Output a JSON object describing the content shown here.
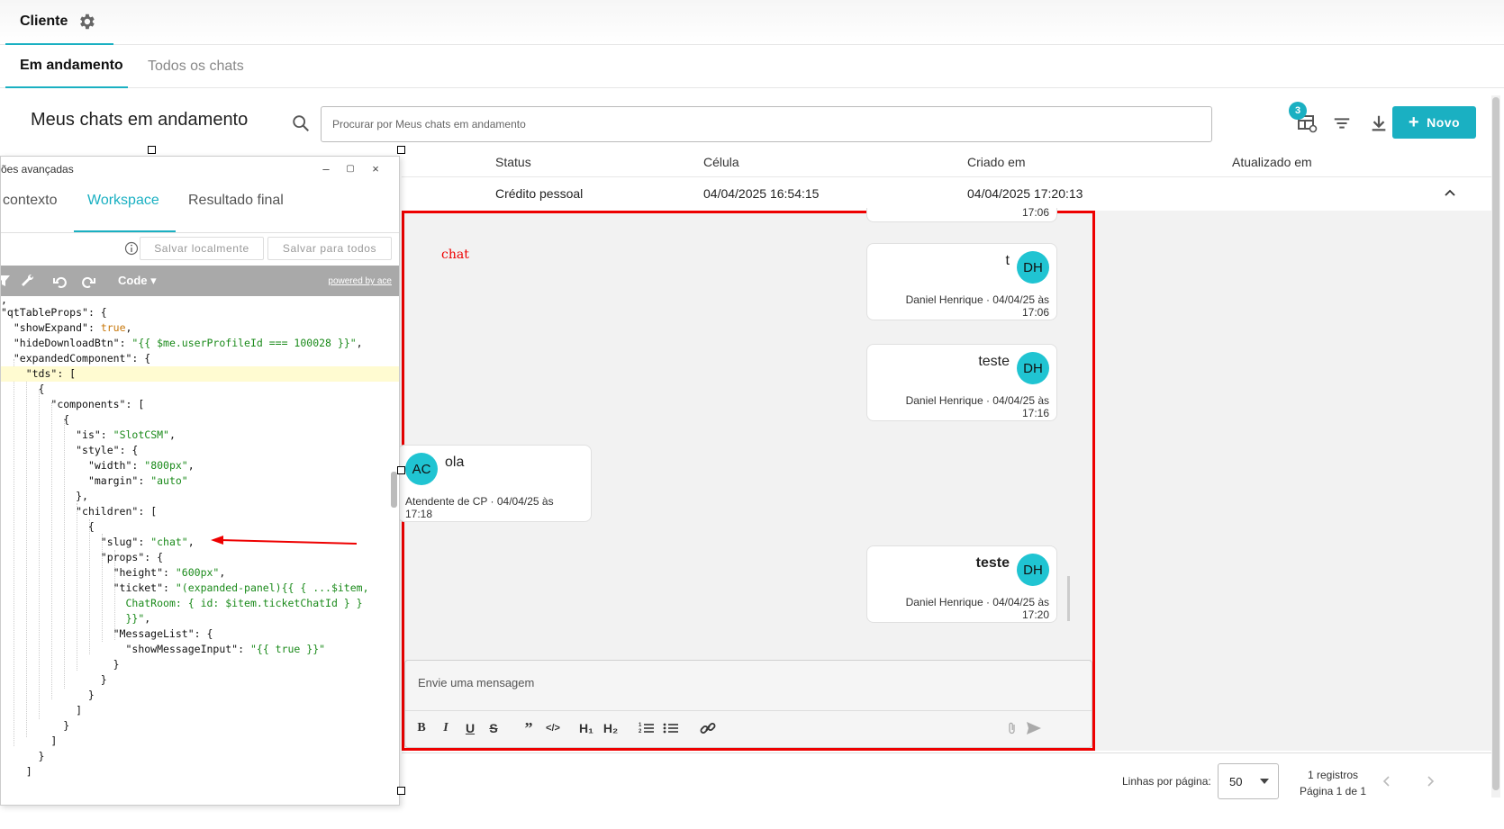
{
  "header": {
    "tab_label": "Cliente"
  },
  "subtabs": {
    "active": "Em andamento",
    "inactive": "Todos os chats"
  },
  "page": {
    "title": "Meus chats em andamento",
    "search_placeholder": "Procurar por Meus chats em andamento",
    "filter_count": "3",
    "new_button": "Novo"
  },
  "table": {
    "headers": {
      "status": "Status",
      "celula": "Célula",
      "criado": "Criado em",
      "atualizado": "Atualizado em"
    },
    "row": {
      "status": "Crédito pessoal",
      "celula": "04/04/2025 16:54:15",
      "criado": "04/04/2025 17:20:13"
    }
  },
  "chat": {
    "annotation": "chat",
    "partial_time": "17:06",
    "messages": [
      {
        "text": "t",
        "avatar": "DH",
        "meta1": "Daniel Henrique · 04/04/25 às",
        "meta2": "17:06"
      },
      {
        "text": "teste",
        "avatar": "DH",
        "meta1": "Daniel Henrique · 04/04/25 às",
        "meta2": "17:16"
      },
      {
        "text": "ola",
        "avatar": "AC",
        "meta1": "Atendente de CP · 04/04/25 às",
        "meta2": "17:18"
      },
      {
        "text": "teste",
        "avatar": "DH",
        "meta1": "Daniel Henrique · 04/04/25 às",
        "meta2": "17:20"
      }
    ],
    "composer_placeholder": "Envie uma mensagem",
    "toolbar": {
      "h1": "H₁",
      "h2": "H₂"
    }
  },
  "pagination": {
    "rows_label": "Linhas por página:",
    "rows_value": "50",
    "records": "1 registros",
    "page": "Página 1 de 1"
  },
  "editor": {
    "title": "ões avançadas",
    "tabs": [
      "contexto",
      "Workspace",
      "Resultado final"
    ],
    "save_local": "Salvar localmente",
    "save_all": "Salvar para todos",
    "mode": "Code",
    "powered": "powered by ace"
  },
  "colors": {
    "accent": "#1ab0c2",
    "avatar": "#20c4d2",
    "annotation_red": "#e00000"
  }
}
